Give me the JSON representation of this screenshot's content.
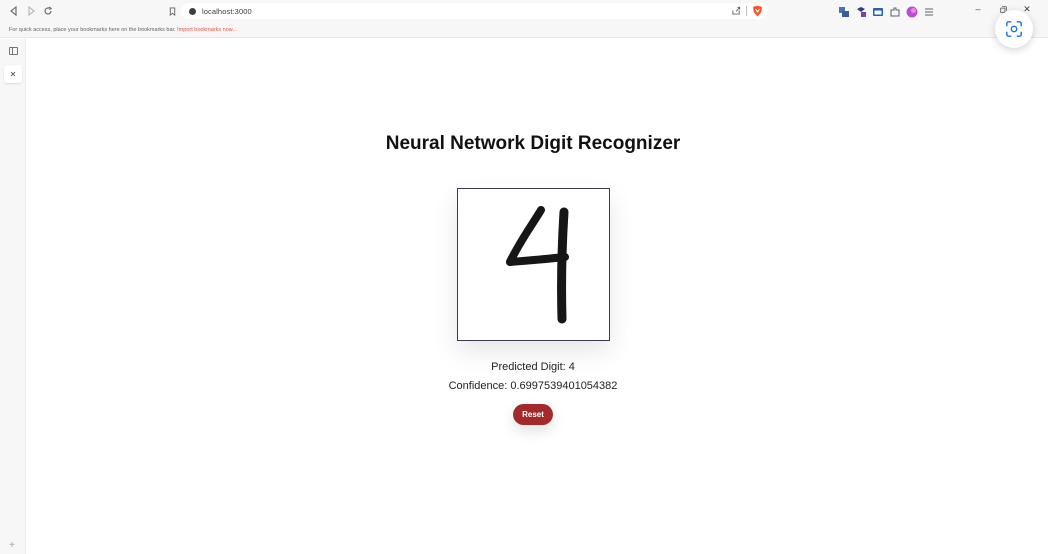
{
  "browser": {
    "url": "localhost:3000",
    "bookmarks_bar": {
      "message": "For quick access, place your bookmarks here on the bookmarks bar. ",
      "link": "Import bookmarks now..."
    },
    "colors": {
      "accent": "#e8523b",
      "brave": "#fb542b"
    }
  },
  "page": {
    "title": "Neural Network Digit Recognizer",
    "prediction_text": "Predicted Digit: 4",
    "confidence_text": "Confidence: 0.6997539401054382",
    "reset_label": "Reset",
    "colors": {
      "reset_button": "#a32a2a",
      "canvas_border": "#3b3a55"
    }
  }
}
